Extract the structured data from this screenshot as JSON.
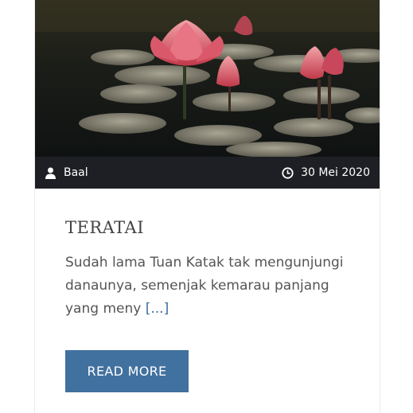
{
  "post": {
    "title": "TERATAI",
    "excerpt": "Sudah lama Tuan Katak tak mengunjungi danaunya, semenjak kemarau panjang yang meny",
    "excerpt_more": "[...]",
    "read_more_label": "READ MORE"
  },
  "meta": {
    "author": "Baal",
    "date": "30 Mei 2020"
  },
  "colors": {
    "meta_bar": "#1e1f24",
    "button": "#41719f",
    "link": "#3e6b9a",
    "text": "#555555"
  },
  "icons": {
    "author": "user-icon",
    "date": "clock-icon"
  }
}
